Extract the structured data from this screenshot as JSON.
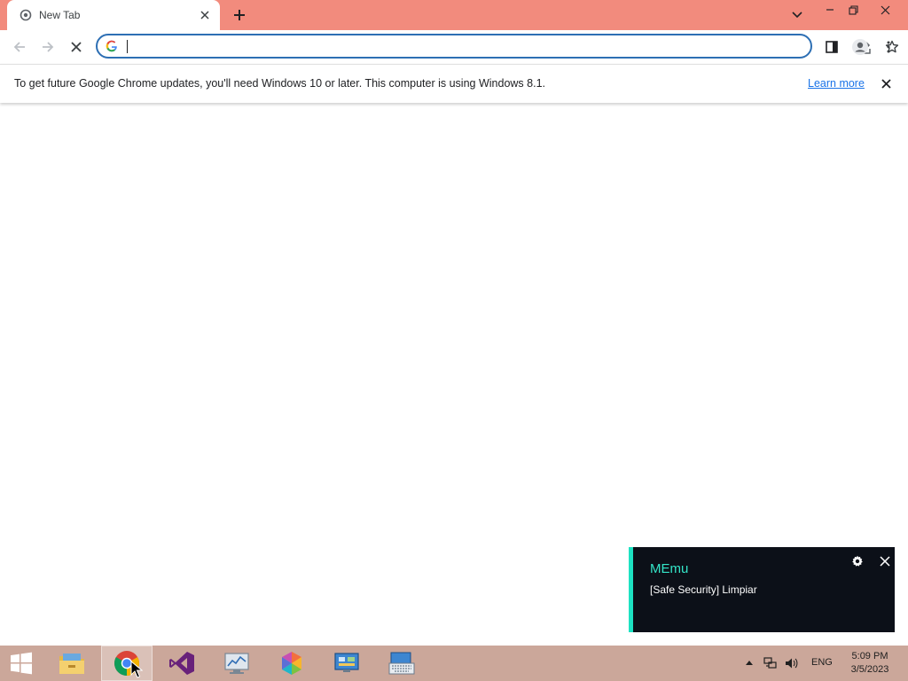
{
  "browser": {
    "tab": {
      "title": "New Tab"
    },
    "omnibox": {
      "value": "",
      "placeholder": ""
    },
    "infobar": {
      "message": "To get future Google Chrome updates, you'll need Windows 10 or later. This computer is using Windows 8.1.",
      "link_label": "Learn more"
    }
  },
  "notification": {
    "app_name": "MEmu",
    "body": "[Safe Security] Limpiar",
    "accent_color": "#1de2c2"
  },
  "taskbar": {
    "apps": [
      {
        "name": "file-explorer"
      },
      {
        "name": "google-chrome",
        "active": true
      },
      {
        "name": "visual-studio"
      },
      {
        "name": "performance-monitor"
      },
      {
        "name": "memu"
      },
      {
        "name": "control-panel"
      },
      {
        "name": "on-screen-keyboard"
      }
    ],
    "tray": {
      "language": "ENG",
      "time": "5:09 PM",
      "date": "3/5/2023"
    }
  },
  "colors": {
    "tabstrip": "#f28b7d",
    "taskbar": "#cba79a",
    "omnibox_border": "#2d6fb4",
    "link": "#1a73e8"
  }
}
